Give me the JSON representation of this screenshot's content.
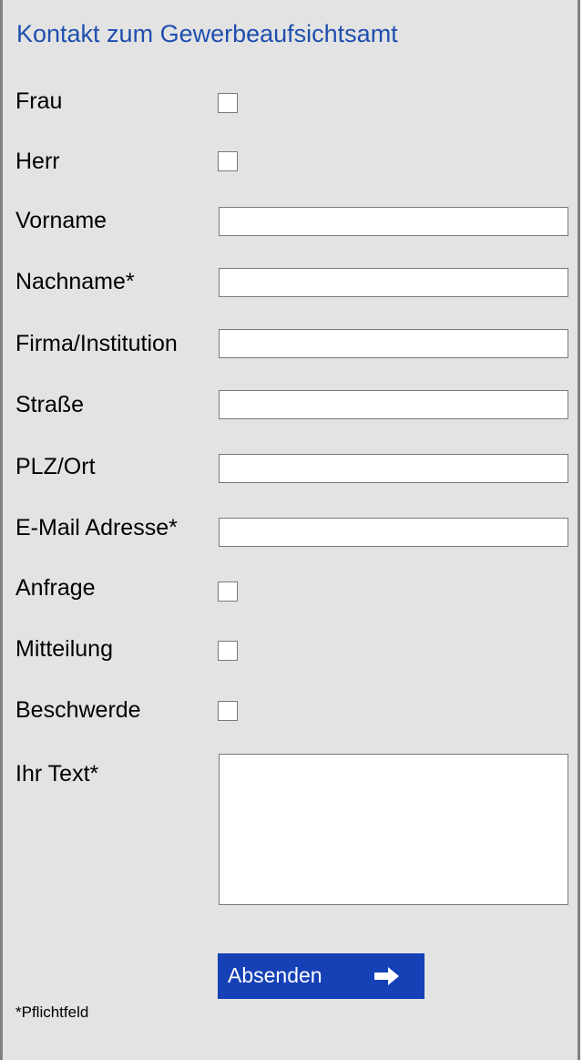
{
  "form": {
    "title": "Kontakt zum Gewerbeaufsichtsamt",
    "salutation": {
      "frau_label": "Frau",
      "herr_label": "Herr"
    },
    "fields": {
      "vorname": {
        "label": "Vorname",
        "value": ""
      },
      "nachname": {
        "label": "Nachname*",
        "value": ""
      },
      "firma": {
        "label": "Firma/Institution",
        "value": ""
      },
      "strasse": {
        "label": "Straße",
        "value": ""
      },
      "plz_ort": {
        "label": "PLZ/Ort",
        "value": ""
      },
      "email": {
        "label": "E-Mail Adresse*",
        "value": ""
      }
    },
    "type": {
      "anfrage_label": "Anfrage",
      "mitteilung_label": "Mitteilung",
      "beschwerde_label": "Beschwerde"
    },
    "message": {
      "label": "Ihr Text*",
      "value": ""
    },
    "submit_label": "Absenden",
    "submit_icon": "arrow-right-icon",
    "required_note": "*Pflichtfeld"
  },
  "colors": {
    "title": "#1f4fae",
    "button": "#1540b6",
    "panel_background": "#e3e3e3"
  }
}
